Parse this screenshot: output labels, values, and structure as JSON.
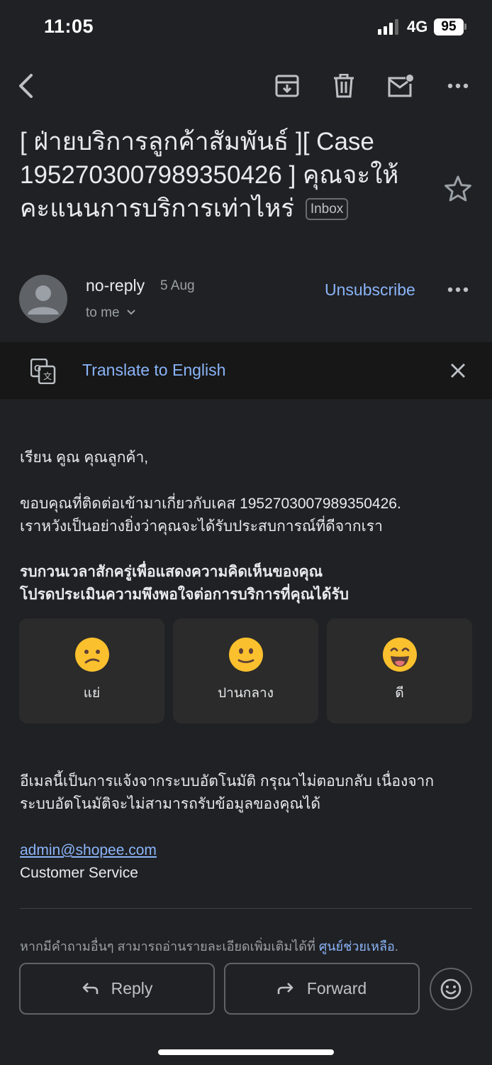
{
  "status_bar": {
    "time": "11:05",
    "network": "4G",
    "battery": "95"
  },
  "toolbar": {
    "back_icon": "arrow-back-icon",
    "archive_icon": "archive-icon",
    "delete_icon": "trash-icon",
    "mark_unread_icon": "mail-unread-icon",
    "more_icon": "more-horizontal-icon"
  },
  "email": {
    "subject": "[ ฝ่ายบริการลูกค้าสัมพันธ์ ][ Case 1952703007989350426 ] คุณจะให้คะแนนการบริการเท่าไหร่",
    "label": "Inbox",
    "sender": "no-reply",
    "date": "5 Aug",
    "to": "to me",
    "unsubscribe": "Unsubscribe"
  },
  "translate": {
    "text": "Translate to English"
  },
  "body": {
    "greeting": "เรียน คูณ คุณลูกค้า,",
    "para1_line1": "ขอบคุณที่ติดต่อเข้ามาเกี่ยวกับเคส 1952703007989350426.",
    "para1_line2": "เราหวังเป็นอย่างยิ่งว่าคุณจะได้รับประสบการณ์ที่ดีจากเรา",
    "bold_line1": "รบกวนเวลาสักครู่เพื่อแสดงความคิดเห็นของคุณ",
    "bold_line2": "โปรดประเมินความพึงพอใจต่อการบริการที่คุณได้รับ",
    "ratings": [
      {
        "label": "แย่",
        "icon": "sad-face-icon"
      },
      {
        "label": "ปานกลาง",
        "icon": "neutral-face-icon"
      },
      {
        "label": "ดี",
        "icon": "happy-face-icon"
      }
    ],
    "auto_line1": "อีเมลนี้เป็นการแจ้งจากระบบอัตโนมัติ กรุณาไม่ตอบกลับ เนื่องจาก",
    "auto_line2": "ระบบอัตโนมัติจะไม่สามารถรับข้อมูลของคุณได้",
    "email_link": "admin@shopee.com",
    "signature": "Customer Service",
    "footer_text": "หากมีคำถามอื่นๆ สามารถอ่านรายละเอียดเพิ่มเติมได้ที่ ",
    "footer_link": "ศูนย์ช่วยเหลือ",
    "footer_end": "."
  },
  "actions": {
    "reply": "Reply",
    "forward": "Forward"
  },
  "colors": {
    "background": "#202124",
    "link": "#8ab4f8",
    "emoji_yellow": "#fbc02d"
  }
}
